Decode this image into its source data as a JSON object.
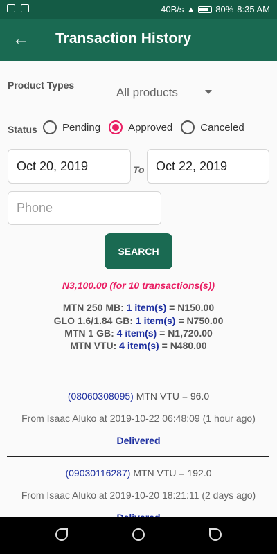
{
  "statusbar": {
    "speed": "40B/s",
    "battery": "80%",
    "time": "8:35 AM"
  },
  "appbar": {
    "title": "Transaction History",
    "back_icon": "←"
  },
  "filters": {
    "product_types_label": "Product Types",
    "product_selected": "All products",
    "status_label": "Status",
    "status_options": [
      "Pending",
      "Approved",
      "Canceled"
    ],
    "status_selected": "Approved",
    "date_from": "Oct 20, 2019",
    "date_to_label": "To",
    "date_to": "Oct 22, 2019",
    "phone_placeholder": "Phone",
    "search_label": "SEARCH"
  },
  "summary": {
    "total": "N3,100.00 (for 10 transactions(s))",
    "lines": [
      {
        "name": "MTN 250 MB:",
        "items": "1 item(s)",
        "amount": "N150.00"
      },
      {
        "name": "GLO 1.6/1.84 GB:",
        "items": "1 item(s)",
        "amount": "N750.00"
      },
      {
        "name": "MTN 1 GB:",
        "items": "4 item(s)",
        "amount": "N1,720.00"
      },
      {
        "name": "MTN VTU:",
        "items": "4 item(s)",
        "amount": "N480.00"
      }
    ]
  },
  "transactions": [
    {
      "phone": "(08060308095)",
      "service": "MTN VTU = 96.0",
      "from": "From Isaac Aluko at 2019-10-22 06:48:09 (1 hour ago)",
      "status": "Delivered"
    },
    {
      "phone": "(09030116287)",
      "service": "MTN VTU = 192.0",
      "from": "From Isaac Aluko at 2019-10-20 18:21:11 (2 days ago)",
      "status": "Delivered"
    }
  ]
}
